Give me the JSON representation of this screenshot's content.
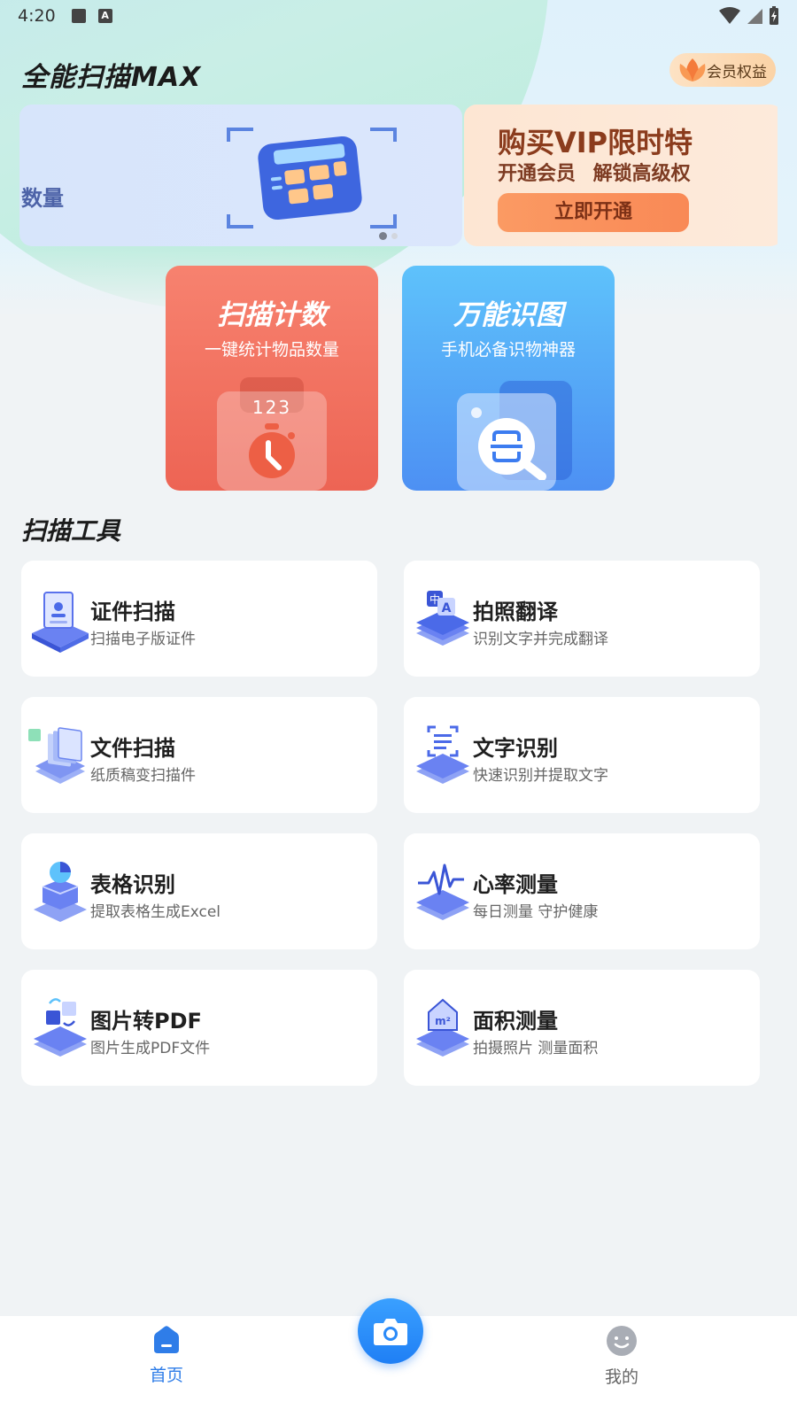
{
  "status_bar": {
    "time": "4:20"
  },
  "header": {
    "title": "全能扫描MAX",
    "vip_label": "会员权益"
  },
  "banner": {
    "slide_a_text": "数量",
    "slide_b_title": "购买VIP限时特",
    "slide_b_subtitle": "开通会员 解锁高级权",
    "slide_b_button": "立即开通",
    "page_count": 2,
    "active_page": 1
  },
  "features": [
    {
      "title": "扫描计数",
      "subtitle": "一键统计物品数量",
      "badge": "123",
      "icon": "stopwatch-icon"
    },
    {
      "title": "万能识图",
      "subtitle": "手机必备识物神器",
      "icon": "magnifier-scan-icon"
    }
  ],
  "tools_section": {
    "title": "扫描工具"
  },
  "tools": [
    {
      "title": "证件扫描",
      "subtitle": "扫描电子版证件",
      "icon": "id-card-icon"
    },
    {
      "title": "拍照翻译",
      "subtitle": "识别文字并完成翻译",
      "icon": "translate-icon"
    },
    {
      "title": "文件扫描",
      "subtitle": "纸质稿变扫描件",
      "icon": "document-scan-icon"
    },
    {
      "title": "文字识别",
      "subtitle": "快速识别并提取文字",
      "icon": "text-recognition-icon"
    },
    {
      "title": "表格识别",
      "subtitle": "提取表格生成Excel",
      "icon": "table-recognition-icon"
    },
    {
      "title": "心率测量",
      "subtitle": "每日测量 守护健康",
      "icon": "heart-rate-icon"
    },
    {
      "title": "图片转PDF",
      "subtitle": "图片生成PDF文件",
      "icon": "image-to-pdf-icon"
    },
    {
      "title": "面积测量",
      "subtitle": "拍摄照片 测量面积",
      "icon": "area-measure-icon"
    }
  ],
  "bottom_nav": {
    "home_label": "首页",
    "mine_label": "我的"
  },
  "colors": {
    "accent_blue": "#2f7de8",
    "feature_red": "#ed6454",
    "feature_blue": "#4d90f3",
    "vip_orange": "#f98956"
  }
}
